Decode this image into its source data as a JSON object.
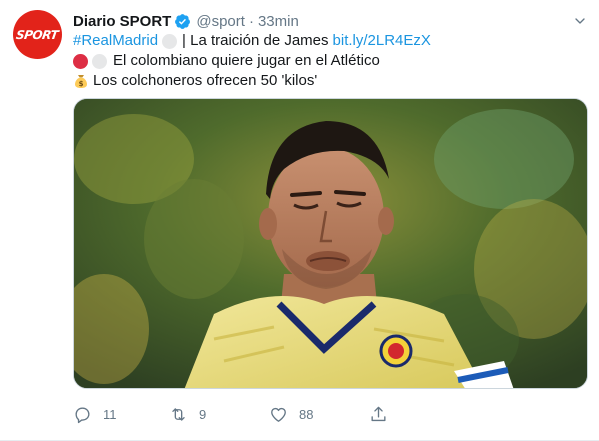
{
  "tweet": {
    "author": {
      "avatar_text": "SPORT",
      "display_name": "Diario SPORT",
      "handle": "@sport",
      "separator": "·",
      "time": "33min"
    },
    "text": {
      "hashtag": "#RealMadrid",
      "line1_middle": "| La traición de James",
      "line1_link": "bit.ly/2LR4EzX",
      "line2": "El colombiano quiere jugar en el Atlético",
      "line3": "Los colchoneros ofrecen 50 'kilos'"
    },
    "actions": {
      "reply_count": "11",
      "retweet_count": "9",
      "like_count": "88"
    }
  },
  "colors": {
    "link": "#1b95e0",
    "secondary_text": "#657786",
    "brand_red": "#e2231a",
    "verified": "#1da1f2"
  },
  "icons": [
    "verified-badge-icon",
    "caret-down-icon",
    "money-bag-icon",
    "reply-icon",
    "retweet-icon",
    "like-icon",
    "share-icon"
  ]
}
